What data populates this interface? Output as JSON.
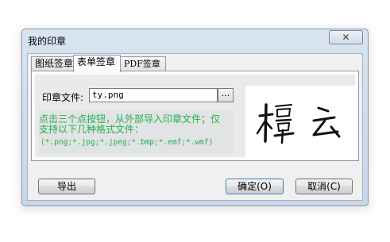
{
  "window": {
    "title": "我的印章",
    "close_glyph": "✕"
  },
  "tabs": [
    {
      "label": "图纸签章"
    },
    {
      "label": "表单签章"
    },
    {
      "label": "PDF签章"
    }
  ],
  "form": {
    "file_label": "印章文件:",
    "file_value": "ty.png",
    "browse_label": "...",
    "hint_line1": "点击三个点按钮，从外部导入印章文件；仅",
    "hint_line2": "支持以下几种格式文件：",
    "formats": "(*.png;*.jpg;*.jpeg;*.bmp;*.emf;*.wmf)"
  },
  "preview": {
    "signature_text": "檀云"
  },
  "buttons": {
    "export": "导出",
    "ok": "确定(O)",
    "cancel": "取消(C)"
  },
  "colors": {
    "hint": "#22b14c",
    "accent": "#3c7fb1"
  }
}
